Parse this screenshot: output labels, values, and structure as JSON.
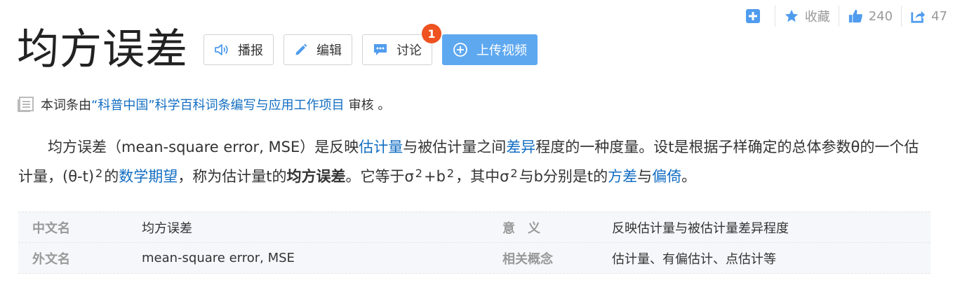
{
  "toolbar": {
    "add_label": "",
    "favorite_label": "收藏",
    "like_count": "240",
    "share_count": "47"
  },
  "header": {
    "title": "均方误差",
    "buttons": {
      "play_label": "播报",
      "edit_label": "编辑",
      "discuss_label": "讨论",
      "discuss_badge": "1",
      "upload_label": "上传视频"
    }
  },
  "review": {
    "prefix": "本词条由",
    "link": "“科普中国”科学百科词条编写与应用工作项目",
    "suffix": "审核 。"
  },
  "summary": {
    "t1": "均方误差（mean-square error, MSE）是反映",
    "l1": "估计量",
    "t2": "与被估计量之间",
    "l2": "差异",
    "t3": "程度的一种度量。设t是根据子样确定的总体参数θ的一个估计量，(θ-t)",
    "s1": "2",
    "t4": "的",
    "l3": "数学期望",
    "t5": "，称为估计量t的",
    "bold": "均方误差",
    "t6": "。它等于σ",
    "s2": "2",
    "t7": "+b",
    "s3": "2",
    "t8": "，其中σ",
    "s4": "2",
    "t9": "与b分别是t的",
    "l4": "方差",
    "t10": "与",
    "l5": "偏倚",
    "t11": "。"
  },
  "basic_info": {
    "rows": [
      {
        "k1": "中文名",
        "v1": "均方误差",
        "k2": "意　义",
        "v2": "反映估计量与被估计量差异程度"
      },
      {
        "k1": "外文名",
        "v1": "mean-square error, MSE",
        "k2": "相关概念",
        "v2": "估计量、有偏估计、点估计等"
      }
    ]
  },
  "colors": {
    "link": "#136ec2",
    "primary": "#5ea8f0",
    "badge": "#ee5220",
    "icon": "#4f9cee"
  }
}
